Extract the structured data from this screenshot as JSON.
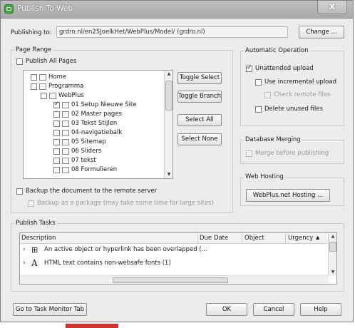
{
  "window": {
    "title": "Publish To Web",
    "close_glyph": "x"
  },
  "publishing": {
    "label": "Publishing to:",
    "path": "grdro.nl/en25JoelkHet/WebPlus/Model/ (grdro.nl)",
    "change_button": "Change ..."
  },
  "page_range": {
    "title": "Page Range",
    "publish_all": "Publish All Pages",
    "tree": [
      {
        "label": "Home",
        "checked": false
      },
      {
        "label": "Programma",
        "checked": false
      },
      {
        "label": "WebPlus",
        "checked": false
      },
      {
        "label": "01 Setup Nieuwe Site",
        "checked": true
      },
      {
        "label": "02 Master pages",
        "checked": false
      },
      {
        "label": "03 Tekst Stijlen",
        "checked": false
      },
      {
        "label": "04-navigatiebalk",
        "checked": false
      },
      {
        "label": "05 Sitemap",
        "checked": false
      },
      {
        "label": "06 Sliders",
        "checked": false
      },
      {
        "label": "07 tekst",
        "checked": false
      },
      {
        "label": "08 Formulieren",
        "checked": false
      }
    ],
    "toggle_select": "Toggle Select",
    "toggle_branch": "Toggle Branch",
    "select_all": "Select All",
    "select_none": "Select None",
    "backup_document": "Backup the document to the remote server",
    "backup_package": "Backup as a package (may take some time for large sites)"
  },
  "automatic_operation": {
    "title": "Automatic Operation",
    "unattended": "Unattended upload",
    "incremental": "Use incremental upload",
    "check_remote": "Check remote files",
    "delete_unused": "Delete unused files"
  },
  "database_merging": {
    "title": "Database Merging",
    "merge": "Merge before publishing"
  },
  "web_hosting": {
    "title": "Web Hosting",
    "button": "WebPlus.net Hosting ..."
  },
  "publish_tasks": {
    "title": "Publish Tasks",
    "columns": [
      "Description",
      "Due Date",
      "Object",
      "Urgency"
    ],
    "rows": [
      {
        "text": "An active object or hyperlink has been overlapped (..."
      },
      {
        "text": "HTML text contains non-websafe fonts (1)"
      }
    ]
  },
  "footer": {
    "task_monitor": "Go to Task Monitor Tab",
    "ok": "OK",
    "cancel": "Cancel",
    "help": "Help"
  }
}
